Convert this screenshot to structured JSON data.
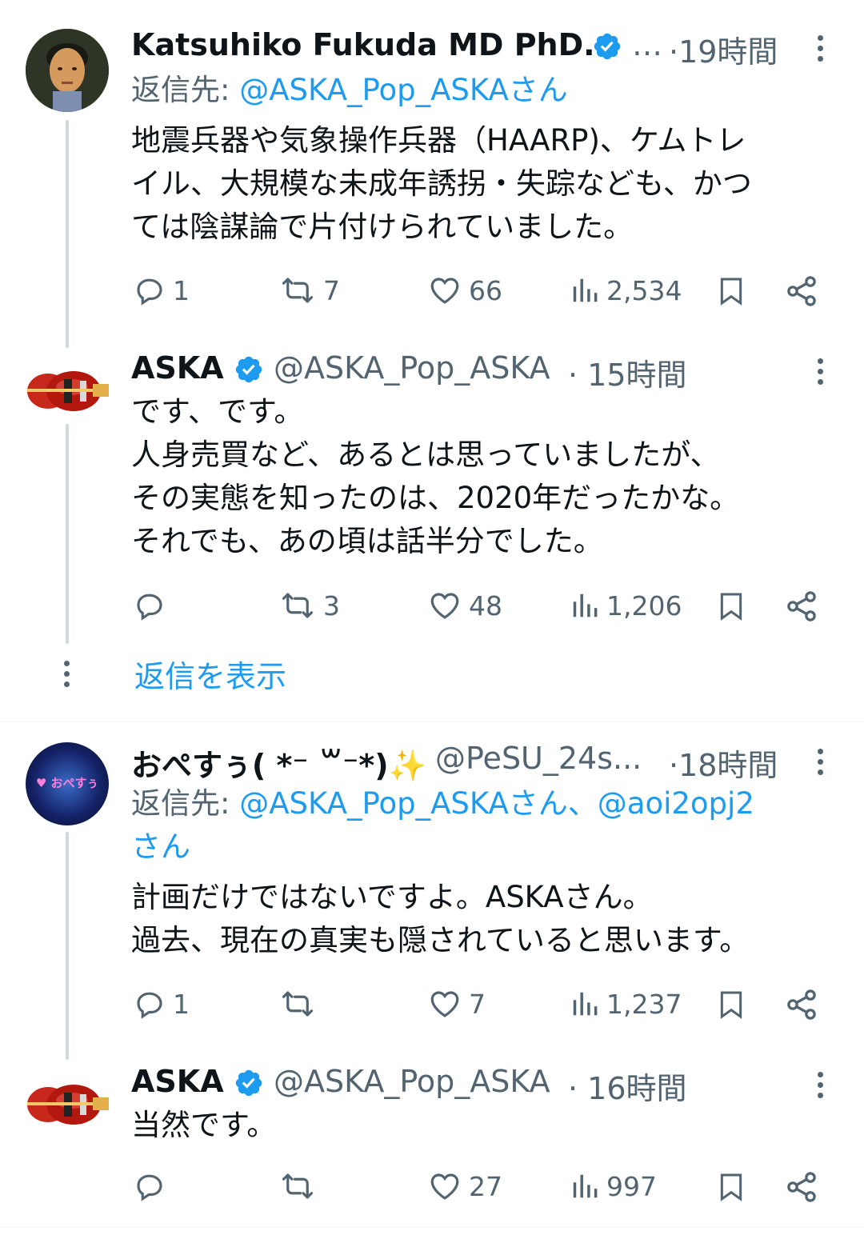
{
  "colors": {
    "accent": "#1d9bf0",
    "muted": "#536471",
    "text": "#0f1419"
  },
  "tweets": [
    {
      "name": "Katsuhiko Fukuda MD PhD...",
      "handle": "…",
      "time": "·19時間",
      "reply_label": "返信先: ",
      "reply_to": "@ASKA_Pop_ASKAさん",
      "lines": [
        "地震兵器や気象操作兵器（HAARP)、ケムトレ",
        "イル、大規模な未成年誘拐・失踪なども、かつ",
        "ては陰謀論で片付けられていました。"
      ],
      "replies": "1",
      "retweets": "7",
      "likes": "66",
      "views": "2,534"
    },
    {
      "name": "ASKA",
      "handle": "@ASKA_Pop_ASKA",
      "time": "· 15時間",
      "lines": [
        "です、です。",
        "人身売買など、あるとは思っていましたが、",
        "その実態を知ったのは、2020年だったかな。",
        "それでも、あの頃は話半分でした。"
      ],
      "replies": "",
      "retweets": "3",
      "likes": "48",
      "views": "1,206"
    },
    {
      "name": "おぺすぅ( *⁻ ꒳⁻*)✨",
      "handle": "@PeSU_24s...",
      "time": "·18時間",
      "reply_label": "返信先: ",
      "reply_to": "@ASKA_Pop_ASKAさん、@aoi2opj2",
      "reply_to_2": "さん",
      "lines": [
        "計画だけではないですよ。ASKAさん。",
        "過去、現在の真実も隠されていると思います。"
      ],
      "replies": "1",
      "retweets": "",
      "likes": "7",
      "views": "1,237"
    },
    {
      "name": "ASKA",
      "handle": "@ASKA_Pop_ASKA",
      "time": "· 16時間",
      "lines": [
        "当然です。"
      ],
      "replies": "",
      "retweets": "",
      "likes": "27",
      "views": "997"
    }
  ],
  "show_replies": "返信を表示",
  "avatar_3_text": "♥ おぺすぅ"
}
